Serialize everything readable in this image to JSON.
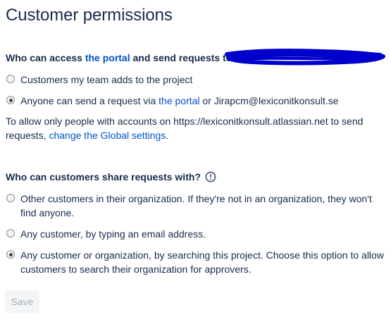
{
  "page": {
    "title": "Customer permissions"
  },
  "access_section": {
    "heading_prefix": "Who can access ",
    "heading_link": "the portal",
    "heading_suffix": " and send requests to",
    "options": [
      {
        "label": "Customers my team adds to the project",
        "checked": false
      },
      {
        "label_prefix": "Anyone can send a request via ",
        "label_link": "the portal",
        "label_suffix": " or Jirapcm@lexiconitkonsult.se",
        "checked": true
      }
    ],
    "info_text": "To allow only people with accounts on https://lexiconitkonsult.atlassian.net to send requests, ",
    "info_link": "change the Global settings",
    "info_suffix": "."
  },
  "share_section": {
    "heading": "Who can customers share requests with?",
    "icon": "info-circle-icon",
    "options": [
      {
        "label": "Other customers in their organization. If they're not in an organization, they won't find anyone.",
        "checked": false
      },
      {
        "label": "Any customer, by typing an email address.",
        "checked": false
      },
      {
        "label": "Any customer or organization, by searching this project. Choose this option to allow customers to search their organization for approvers.",
        "checked": true
      }
    ]
  },
  "actions": {
    "save_label": "Save",
    "save_disabled": true
  },
  "colors": {
    "text": "#172b4d",
    "link": "#0052cc",
    "redaction": "#0000cc",
    "button_bg": "#f4f5f7",
    "button_text": "#a5adba"
  }
}
